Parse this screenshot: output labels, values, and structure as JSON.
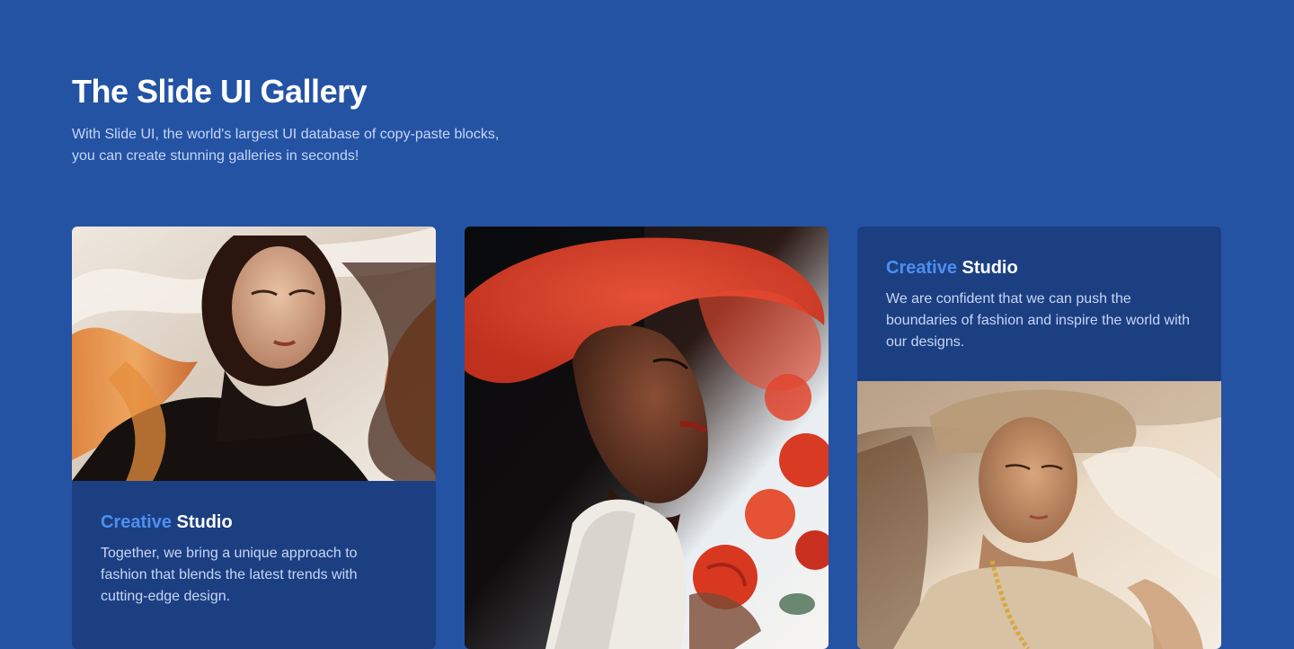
{
  "header": {
    "title": "The Slide UI Gallery",
    "subtitle": "With Slide UI, the world's largest UI database of copy-paste blocks,\nyou can create stunning galleries in seconds!"
  },
  "cards": [
    {
      "heading_accent": "Creative",
      "heading_plain": "Studio",
      "text": "Together, we bring a unique approach to fashion that blends the latest trends with cutting-edge design.",
      "image": "portrait-woman-flowing-hair"
    },
    {
      "image": "portrait-woman-red-hat-roses"
    },
    {
      "heading_accent": "Creative",
      "heading_plain": "Studio",
      "text": "We are confident that we can push the boundaries of fashion and inspire the world with our designs.",
      "image": "portrait-woman-veil-sunlight"
    }
  ],
  "colors": {
    "background": "#2453a4",
    "panel": "#1c3f82",
    "accent": "#4d8ff0",
    "muted_text": "#c7d6f5"
  }
}
